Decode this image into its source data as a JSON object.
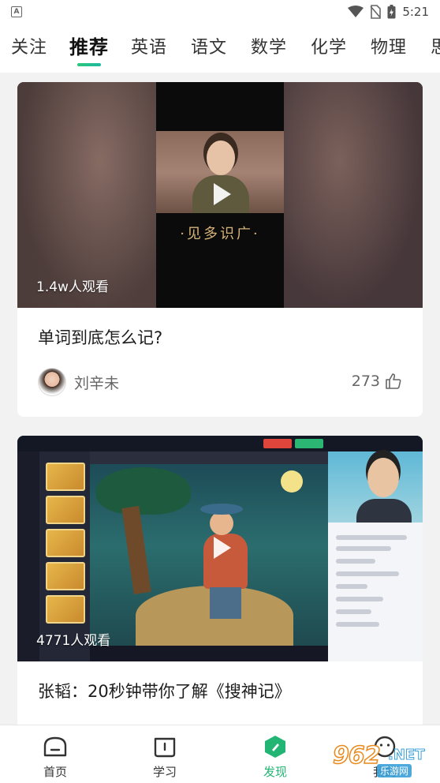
{
  "status_bar": {
    "time": "5:21",
    "icons": [
      "app-notification-icon",
      "wifi-icon",
      "no-sim-icon",
      "battery-charging-icon"
    ]
  },
  "tabs": [
    {
      "label": "关注",
      "active": false
    },
    {
      "label": "推荐",
      "active": true
    },
    {
      "label": "英语",
      "active": false
    },
    {
      "label": "语文",
      "active": false
    },
    {
      "label": "数学",
      "active": false
    },
    {
      "label": "化学",
      "active": false
    },
    {
      "label": "物理",
      "active": false
    },
    {
      "label": "思",
      "active": false
    }
  ],
  "feed": [
    {
      "views": "1.4w人观看",
      "overlay_text": "·见多识广·",
      "title": "单词到底怎么记?",
      "author": "刘辛未",
      "likes": "273"
    },
    {
      "views": "4771人观看",
      "title": "张韬：20秒钟带你了解《搜神记》"
    }
  ],
  "bottom_nav": [
    {
      "label": "首页",
      "icon": "home-icon",
      "active": false
    },
    {
      "label": "学习",
      "icon": "book-icon",
      "active": false
    },
    {
      "label": "发现",
      "icon": "discover-icon",
      "active": true
    },
    {
      "label": "我的",
      "icon": "profile-icon",
      "active": false
    }
  ],
  "watermark": {
    "brand": "962",
    "suffix": ".NET",
    "sub": "乐游网"
  },
  "colors": {
    "accent": "#22b573",
    "background": "#f2f2f2",
    "card": "#ffffff"
  }
}
